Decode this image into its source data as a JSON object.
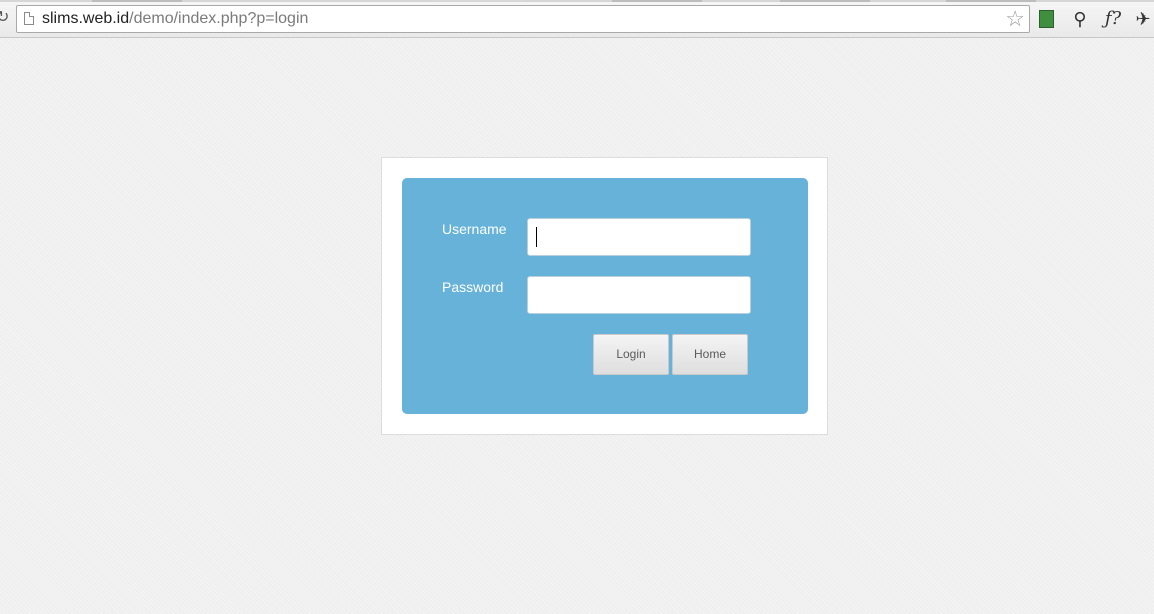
{
  "browser": {
    "url_host": "slims.web.id",
    "url_path": "/demo/index.php?p=login",
    "icons": [
      "back-icon",
      "page-icon",
      "bookmark-star-icon",
      "extension-icon-1",
      "extension-icon-2",
      "extension-icon-3",
      "extension-icon-4"
    ],
    "ext_glyphs": {
      "ext2": "⚲",
      "ext3": "ƒ?",
      "ext4": "✈"
    }
  },
  "login": {
    "username_label": "Username",
    "password_label": "Password",
    "username_value": "",
    "password_value": "",
    "login_button": "Login",
    "home_button": "Home"
  },
  "colors": {
    "panel": "#66b2d8",
    "background": "#efefef"
  }
}
